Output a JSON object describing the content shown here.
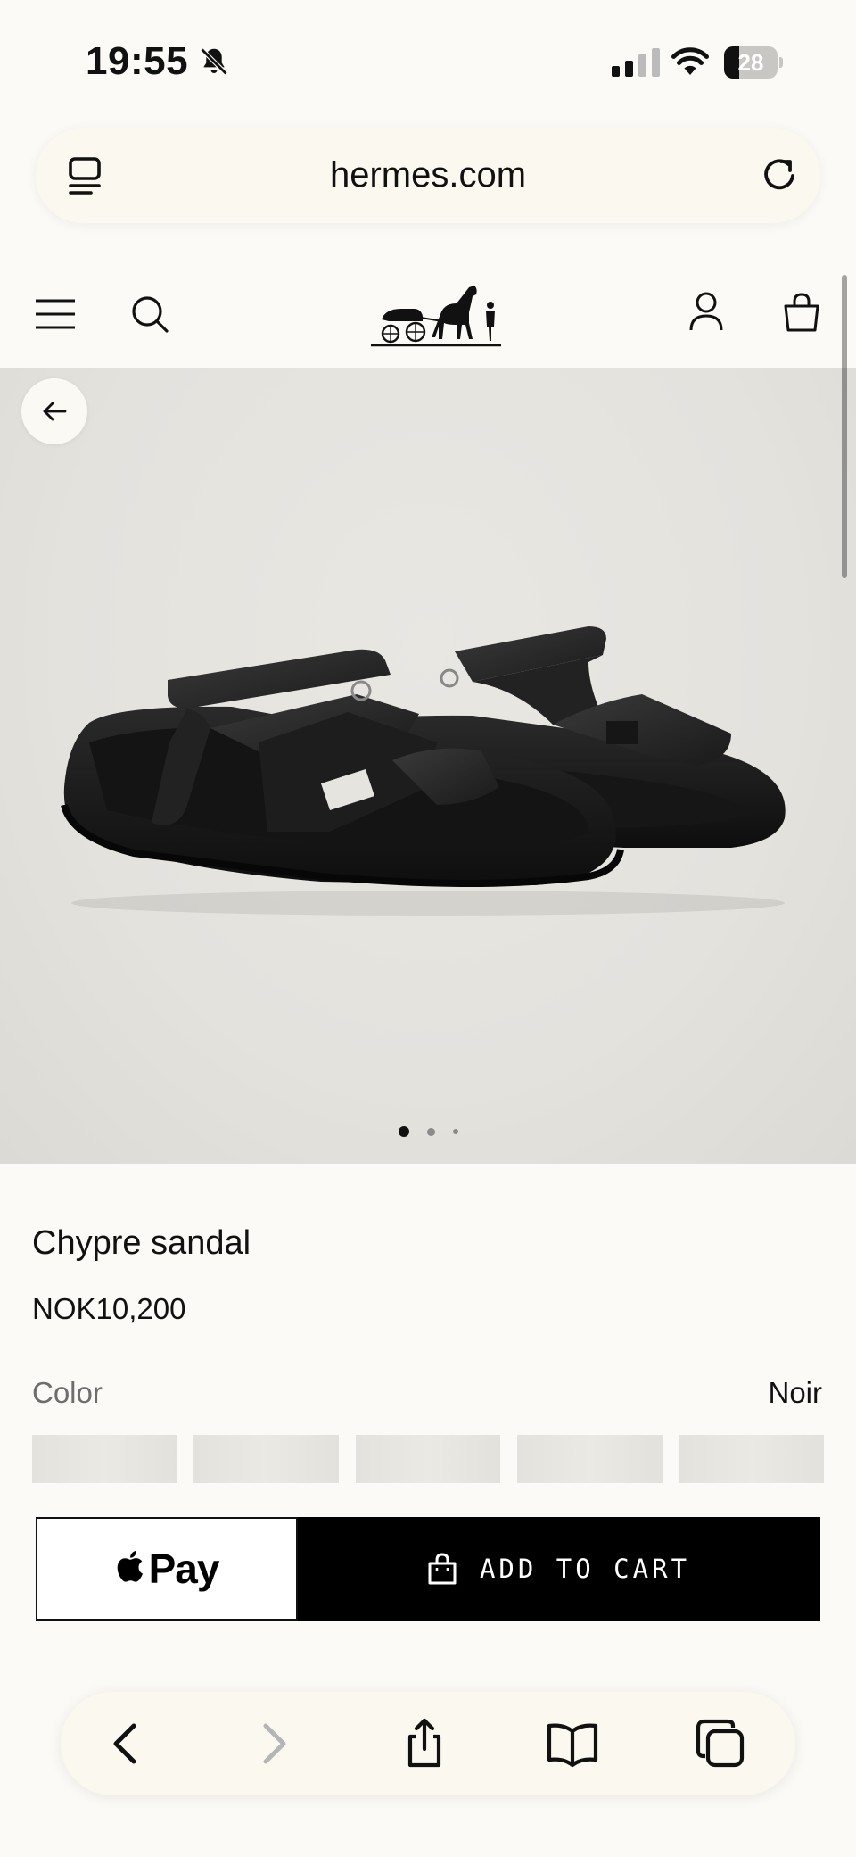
{
  "status_bar": {
    "time": "19:55",
    "battery_level": "28",
    "signal_bars_active": 2,
    "signal_bars_total": 4
  },
  "browser": {
    "url": "hermes.com"
  },
  "site_header": {
    "icons": [
      "menu-icon",
      "search-icon",
      "hermes-carriage-logo",
      "account-icon",
      "shopping-bag-icon"
    ]
  },
  "gallery": {
    "image_count": 3,
    "active_index": 0
  },
  "product": {
    "name": "Chypre sandal",
    "price": "NOK10,200",
    "color_label": "Color",
    "color_value": "Noir",
    "swatch_count": 5
  },
  "actions": {
    "apple_pay_label": "Pay",
    "add_to_cart_label": "ADD TO CART"
  },
  "toolbar": {
    "icons": [
      "back-icon",
      "forward-icon",
      "share-icon",
      "bookmarks-icon",
      "tabs-icon"
    ],
    "forward_enabled": false
  },
  "colors": {
    "page_background": "#fcfaf6",
    "image_background": "#e6e4df",
    "button_black": "#000000",
    "text_secondary": "#6d6d6d"
  }
}
